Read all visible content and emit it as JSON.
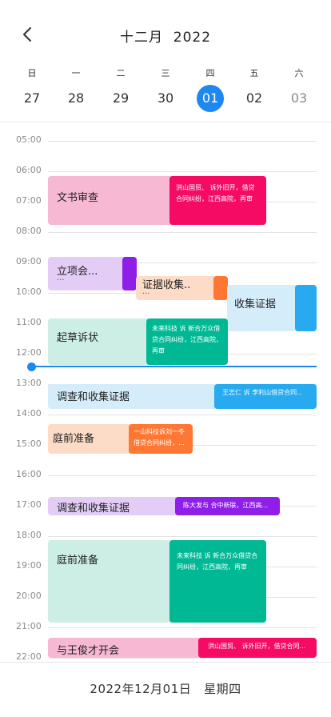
{
  "header": {
    "title": "十二月  2022",
    "back_icon": "chevron-left-icon"
  },
  "week": [
    {
      "weekday": "日",
      "day": "27"
    },
    {
      "weekday": "一",
      "day": "28"
    },
    {
      "weekday": "二",
      "day": "29"
    },
    {
      "weekday": "三",
      "day": "30"
    },
    {
      "weekday": "四",
      "day": "01",
      "selected": true
    },
    {
      "weekday": "五",
      "day": "02"
    },
    {
      "weekday": "六",
      "day": "03"
    }
  ],
  "hours": [
    "05:00",
    "06:00",
    "07:00",
    "08:00",
    "09:00",
    "10:00",
    "11:00",
    "12:00",
    "13:00",
    "14:00",
    "15:00",
    "16:00",
    "17:00",
    "18:00",
    "19:00",
    "20:00",
    "21:00",
    "22:00"
  ],
  "events": [
    {
      "title": "文书审查",
      "color": "#f7b8d3"
    },
    {
      "title": "立项会...",
      "subtitle": "...",
      "color": "#e3cdf7"
    },
    {
      "title": "证据收集..",
      "subtitle": "...",
      "color": "#fcdcc6"
    },
    {
      "title": "收集证据",
      "color": "#d5ecfa"
    },
    {
      "title": "起草诉状",
      "color": "#cdeee4"
    },
    {
      "title": "调查和收集证据",
      "color": "#d5ecfa"
    },
    {
      "title": "庭前准备",
      "color": "#fcdcc6"
    },
    {
      "title": "调查和收集证据",
      "color": "#e3cdf7"
    },
    {
      "title": "庭前准备",
      "color": "#cdeee4"
    },
    {
      "title": "与王俊才开会",
      "color": "#f7b8d3"
    }
  ],
  "notes": [
    {
      "text": "洪山国贸、 诉外旧开，借贷合同纠纷，江西高院，再审",
      "color": "#f50a64"
    },
    {
      "text": "",
      "color": "#8f1ee8"
    },
    {
      "text": "",
      "color": "#ff7733"
    },
    {
      "text": "",
      "color": "#27aaf0"
    },
    {
      "text": "未来科技 诉 新合万众借贷合同纠纷，江西高院，再审",
      "color": "#00b894"
    },
    {
      "text": "王志仁 诉  李利山借贷合同...",
      "color": "#27aaf0"
    },
    {
      "text": "一山科技诉刘一冬借贷合同纠纷，...",
      "color": "#ff7733"
    },
    {
      "text": "陈大发与 合中新联，江西高...",
      "color": "#8f1ee8"
    },
    {
      "text": "未来科技 诉 新合万众借贷合同纠纷，江西高院，再审",
      "color": "#00b894"
    },
    {
      "text": "洪山国贸、 诉外旧开，借贷合同...",
      "color": "#f50a64"
    }
  ],
  "now_indicator": {
    "color": "#1e88f0"
  },
  "footer": {
    "date_text": "2022年12月01日   星期四"
  }
}
